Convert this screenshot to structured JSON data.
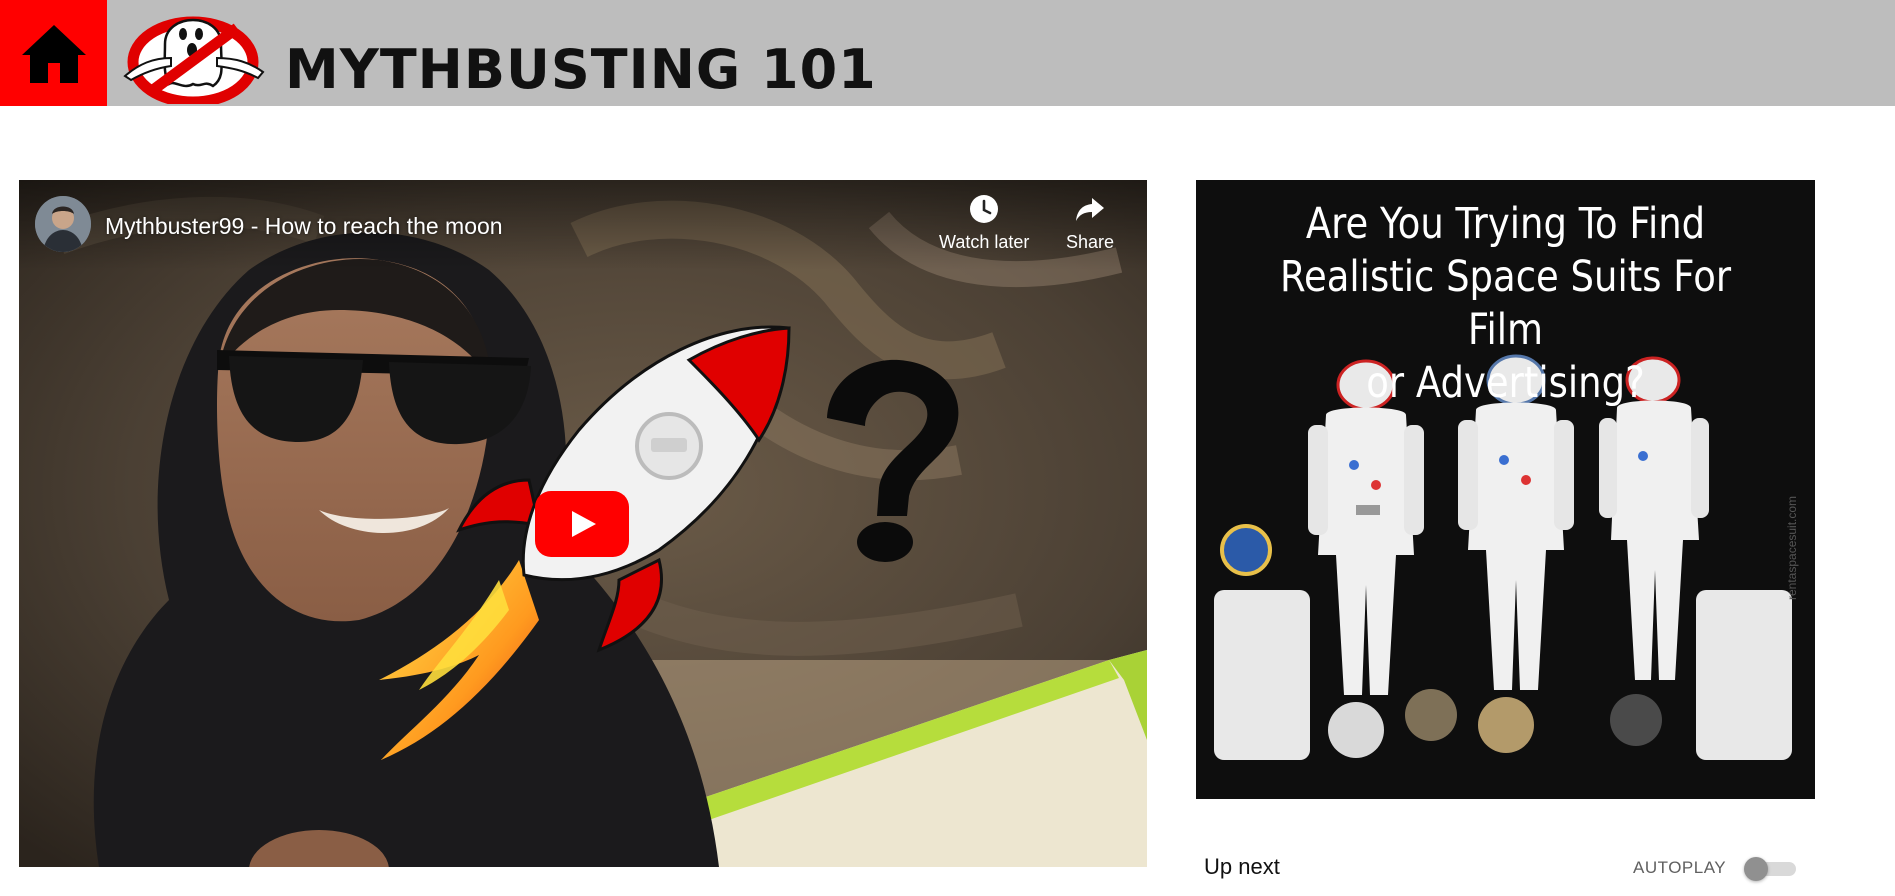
{
  "header": {
    "title": "MYTHBUSTING 101",
    "home_icon": "home-icon",
    "logo": "ghostbusters-logo",
    "colors": {
      "header_bg": "#bdbdbd",
      "home_bg": "#ff0000"
    }
  },
  "video": {
    "title": "Mythbuster99 - How to reach the moon",
    "watch_later_label": "Watch later",
    "share_label": "Share",
    "icons": {
      "watch_later": "clock-icon",
      "share": "share-arrow-icon",
      "play": "youtube-play-icon"
    }
  },
  "ad": {
    "headline": "Are You Trying To Find\nRealistic Space Suits For Film\nor Advertising?",
    "watermark": "rentaspacesuit.com"
  },
  "sidebar": {
    "up_next_label": "Up next",
    "autoplay_label": "AUTOPLAY",
    "autoplay_on": false
  }
}
